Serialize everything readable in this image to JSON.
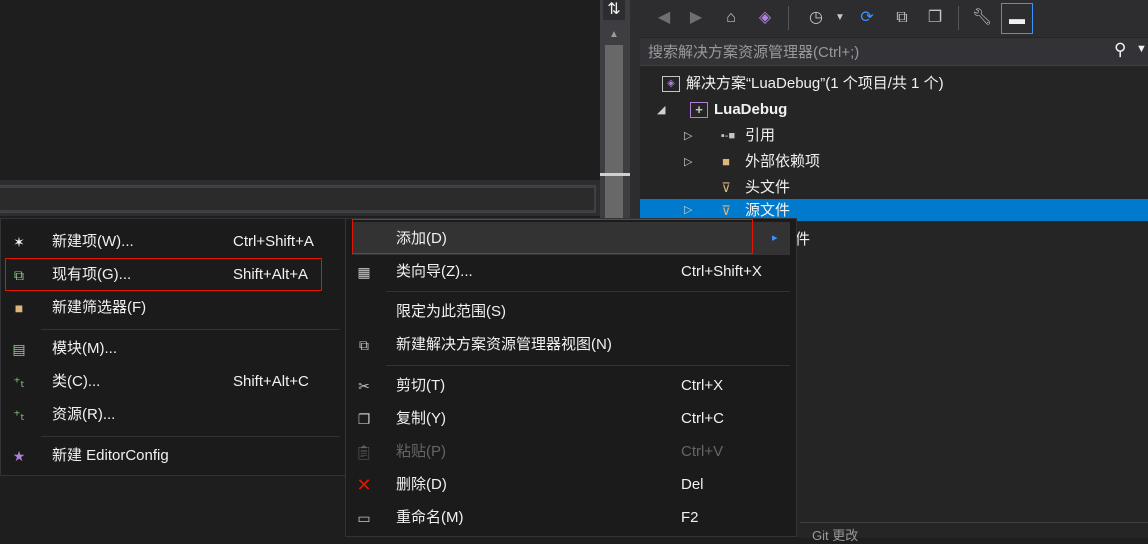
{
  "editor": {
    "split_icon": "⇅"
  },
  "solution_explorer": {
    "toolbar": {
      "icons": [
        "back-icon",
        "forward-icon",
        "home-icon",
        "vs-switch-views-icon",
        "history-icon",
        "chevron-down-icon",
        "sync-icon",
        "collapse-all-icon",
        "show-all-files-icon",
        "properties-wrench-icon",
        "preview-pin-icon"
      ]
    },
    "search": {
      "placeholder": "搜索解决方案资源管理器(Ctrl+;)"
    },
    "tree": {
      "solution": "解决方案“LuaDebug”(1 个项目/共 1 个)",
      "project": "LuaDebug",
      "references": "引用",
      "external_deps": "外部依赖项",
      "headers": "头文件",
      "sources": "源文件",
      "resources_partial": "件"
    },
    "git_bar": "Git 更改"
  },
  "add_menu": {
    "items": [
      {
        "label": "新建项(W)...",
        "shortcut": "Ctrl+Shift+A",
        "icon": "new-item-icon"
      },
      {
        "label": "现有项(G)...",
        "shortcut": "Shift+Alt+A",
        "icon": "existing-item-icon"
      },
      {
        "label": "新建筛选器(F)",
        "shortcut": "",
        "icon": "new-filter-icon"
      },
      {
        "label": "模块(M)...",
        "shortcut": "",
        "icon": "module-icon"
      },
      {
        "label": "类(C)...",
        "shortcut": "Shift+Alt+C",
        "icon": "class-icon"
      },
      {
        "label": "资源(R)...",
        "shortcut": "",
        "icon": "resource-icon"
      },
      {
        "label": "新建 EditorConfig",
        "shortcut": "",
        "icon": "editorconfig-icon"
      }
    ]
  },
  "context_menu": {
    "items": [
      {
        "label": "添加(D)",
        "shortcut": "",
        "icon": "",
        "submenu": "▸"
      },
      {
        "label": "类向导(Z)...",
        "shortcut": "Ctrl+Shift+X",
        "icon": "class-wizard-icon"
      },
      {
        "label": "限定为此范围(S)",
        "shortcut": "",
        "icon": ""
      },
      {
        "label": "新建解决方案资源管理器视图(N)",
        "shortcut": "",
        "icon": "new-view-icon"
      },
      {
        "label": "剪切(T)",
        "shortcut": "Ctrl+X",
        "icon": "cut-icon"
      },
      {
        "label": "复制(Y)",
        "shortcut": "Ctrl+C",
        "icon": "copy-icon"
      },
      {
        "label": "粘贴(P)",
        "shortcut": "Ctrl+V",
        "icon": "paste-icon",
        "disabled": true
      },
      {
        "label": "删除(D)",
        "shortcut": "Del",
        "icon": "delete-icon"
      },
      {
        "label": "重命名(M)",
        "shortcut": "F2",
        "icon": "rename-icon"
      }
    ]
  },
  "colors": {
    "accent": "#007acc",
    "highlight_border": "#e51400",
    "delete_red": "#e51400",
    "menu_bg": "#1b1b1c"
  }
}
